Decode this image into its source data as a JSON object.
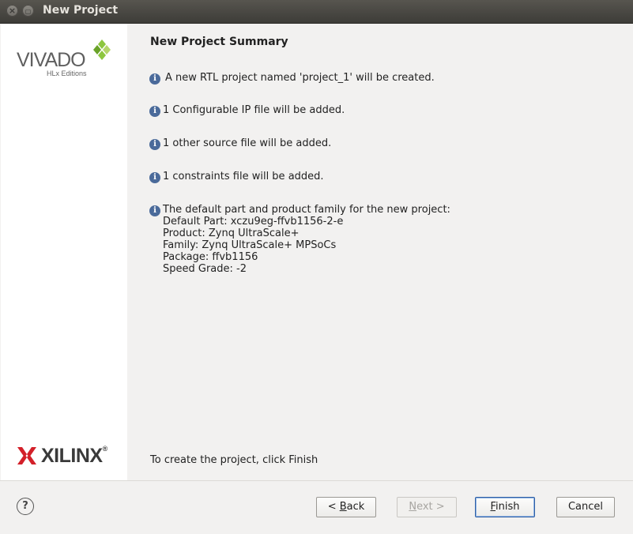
{
  "window": {
    "title": "New Project"
  },
  "sidebar": {
    "vivado_logo_text": "VIVADO",
    "vivado_logo_sub": "HLx Editions",
    "xilinx_logo_text": "XILINX",
    "xilinx_logo_reg": "®"
  },
  "main": {
    "heading": "New Project Summary",
    "info": [
      {
        "text": "A new RTL project named 'project_1' will be created."
      },
      {
        "text": "1 Configurable IP file will be added."
      },
      {
        "text": "1 other source file will be added."
      },
      {
        "text": "1 constraints file will be added."
      },
      {
        "text": "The default part and product family for the new project:",
        "details": [
          "Default Part: xczu9eg-ffvb1156-2-e",
          "Product: Zynq UltraScale+",
          "Family: Zynq UltraScale+ MPSoCs",
          "Package: ffvb1156",
          "Speed Grade: -2"
        ]
      }
    ],
    "footer": "To create the project, click Finish"
  },
  "buttons": {
    "help": "?",
    "back_prefix": "< ",
    "back_underlined": "B",
    "back_rest": "ack",
    "next_underlined": "N",
    "next_rest": "ext >",
    "finish_underlined": "F",
    "finish_rest": "inish",
    "cancel": "Cancel"
  },
  "colors": {
    "accent": "#2f5fa5",
    "info_icon": "#4a6a9a",
    "vivado_green": "#8dc63f",
    "xilinx_red": "#d32029"
  }
}
